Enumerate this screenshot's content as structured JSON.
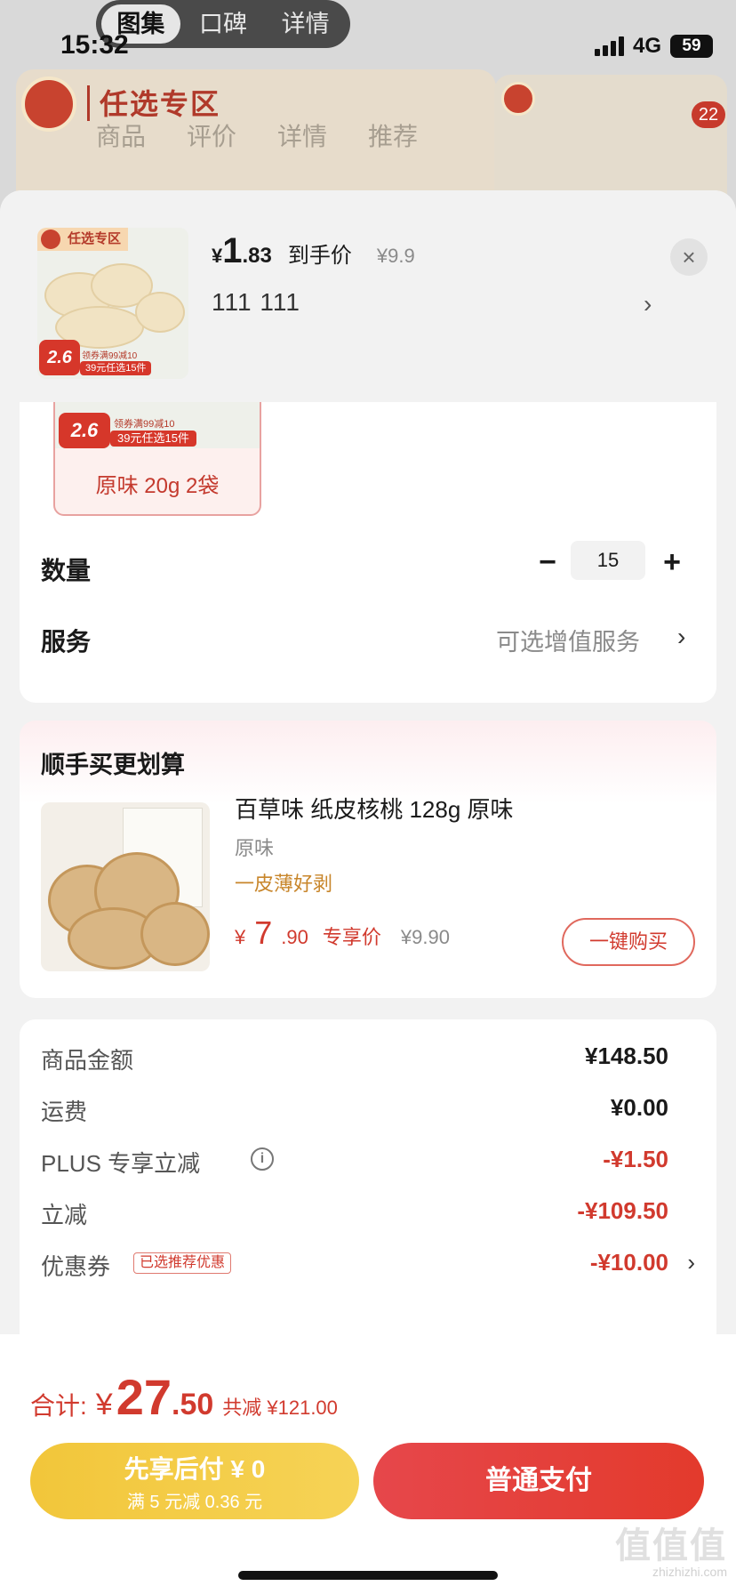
{
  "status_bar": {
    "time": "15:32",
    "network": "4G",
    "battery": "59"
  },
  "top_tabs": [
    {
      "label": "图集",
      "active": true
    },
    {
      "label": "口碑",
      "active": false
    },
    {
      "label": "详情",
      "active": false
    }
  ],
  "background_page": {
    "banner_title": "任选专区",
    "tabs": [
      "商品",
      "评价",
      "详情",
      "推荐"
    ],
    "cart_badge": "22"
  },
  "sheet": {
    "product": {
      "image_tag": "任选专区",
      "image_price": "2.6",
      "image_promo_1": "领券满99减10",
      "image_promo_2": "39元任选15件",
      "price_symbol": "¥",
      "price_int": "1",
      "price_dec": ".83",
      "price_label": "到手价",
      "original_price": "¥9.9",
      "spec": "111  111"
    },
    "option": {
      "label": "原味 20g 2袋",
      "image_price": "2.6",
      "promo_1": "领券满99减10",
      "promo_2": "39元任选15件"
    },
    "quantity": {
      "label": "数量",
      "value": "15"
    },
    "service": {
      "label": "服务",
      "value": "可选增值服务"
    },
    "addon": {
      "title": "顺手买更划算",
      "name": "百草味 纸皮核桃 128g 原味",
      "flavor": "原味",
      "selling_point": "一皮薄好剥",
      "price_symbol": "¥",
      "price_int": "7",
      "price_dec": ".90",
      "price_label": "专享价",
      "original_price": "¥9.90",
      "button_label": "一键购买"
    },
    "summary": {
      "rows": [
        {
          "label": "商品金额",
          "value": "¥148.50"
        },
        {
          "label": "运费",
          "value": "¥0.00"
        },
        {
          "label": "PLUS 专享立减",
          "value": "-¥1.50"
        },
        {
          "label": "立减",
          "value": "-¥109.50"
        },
        {
          "label": "优惠券",
          "tag": "已选推荐优惠",
          "value": "-¥10.00"
        }
      ]
    }
  },
  "footer": {
    "total_label": "合计:",
    "total_symbol": "¥",
    "total_int": "27",
    "total_dec": ".50",
    "total_saving": "共减 ¥121.00",
    "pay_later_line1": "先享后付 ¥ 0",
    "pay_later_line2": "满 5 元减 0.36 元",
    "pay_button": "普通支付"
  },
  "watermark": {
    "main": "值值值",
    "sub": "zhizhizhi.com"
  },
  "colors": {
    "accent_red": "#d13a2e",
    "pay_later_yellow": "#f2c63a",
    "coupon_gold": "#c8862b"
  }
}
